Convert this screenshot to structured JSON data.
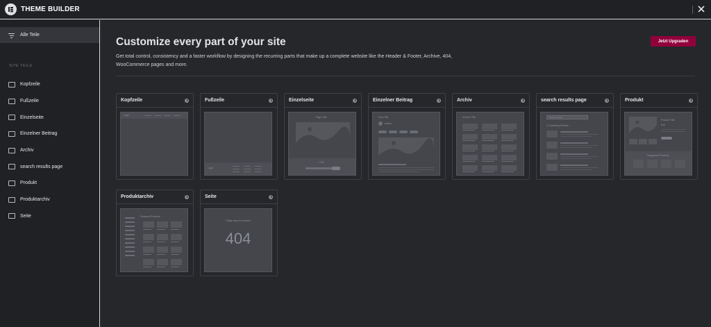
{
  "app": {
    "title": "THEME BUILDER"
  },
  "sidebar": {
    "all_parts_label": "Alle Teile",
    "section_title": "SITE TEILE",
    "items": [
      {
        "label": "Kopfzeile",
        "icon": "header-icon"
      },
      {
        "label": "Fußzeile",
        "icon": "footer-icon"
      },
      {
        "label": "Einzelseite",
        "icon": "single-page-icon"
      },
      {
        "label": "Einzelner Beitrag",
        "icon": "single-post-icon"
      },
      {
        "label": "Archiv",
        "icon": "archive-icon"
      },
      {
        "label": "search results page",
        "icon": "search-results-icon"
      },
      {
        "label": "Produkt",
        "icon": "product-icon"
      },
      {
        "label": "Produktarchiv",
        "icon": "product-archive-icon"
      },
      {
        "label": "Seite",
        "icon": "page-icon"
      }
    ]
  },
  "main": {
    "title": "Customize every part of your site",
    "description": "Get total control, consistency and a faster workflow by designing the recurring parts that make up a complete website like the Header & Footer, Archive, 404, WooCommerce pages and more.",
    "upgrade_label": "Jetzt Upgraden",
    "cards": [
      {
        "title": "Kopfzeile",
        "thumb": {
          "logo": "Logo"
        }
      },
      {
        "title": "Fußzeile",
        "thumb": {
          "logo": "Logo"
        }
      },
      {
        "title": "Einzelseite",
        "thumb": {
          "page_title": "Page Title",
          "cta": "CTA"
        }
      },
      {
        "title": "Einzelner Beitrag",
        "thumb": {
          "post_title": "Post Title",
          "author": "Author"
        }
      },
      {
        "title": "Archiv",
        "thumb": {
          "archive_title": "Archive Title"
        }
      },
      {
        "title": "search results page",
        "thumb": {
          "search_label": "Search results",
          "matching": "12 Matching Results"
        }
      },
      {
        "title": "Produkt",
        "thumb": {
          "product_title": "Product Title",
          "price": "$44",
          "suggested": "Suggested Products"
        }
      },
      {
        "title": "Produktarchiv",
        "thumb": {
          "featured": "Featured Products"
        }
      },
      {
        "title": "Seite",
        "thumb": {
          "not_found": "Page was not found",
          "code": "404"
        }
      }
    ]
  }
}
